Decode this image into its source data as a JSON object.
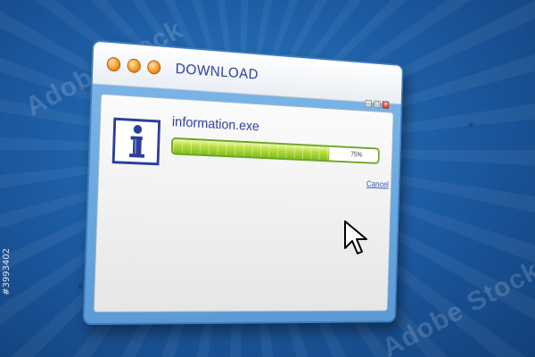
{
  "window": {
    "title": "DOWNLOAD",
    "dots": [
      "orange",
      "orange",
      "orange"
    ],
    "window_controls": [
      "minimize-icon",
      "maximize-icon",
      "close-icon"
    ]
  },
  "download": {
    "filename": "information.exe",
    "progress": 0.75,
    "progress_label": "75%",
    "cancel_label": "Cancel"
  },
  "icons": {
    "file_type": "info-icon",
    "pointer": "mouse-cursor-icon"
  },
  "overlays": {
    "watermark": "Adobe Stock",
    "stock_id": "#3993402"
  },
  "colors": {
    "accent": "#2a3f9a",
    "progress_green": "#8cc63f",
    "window_blue": "#5a9ad6",
    "dot_orange": "#f49a2c",
    "background_blue": "#1d5ea6"
  }
}
